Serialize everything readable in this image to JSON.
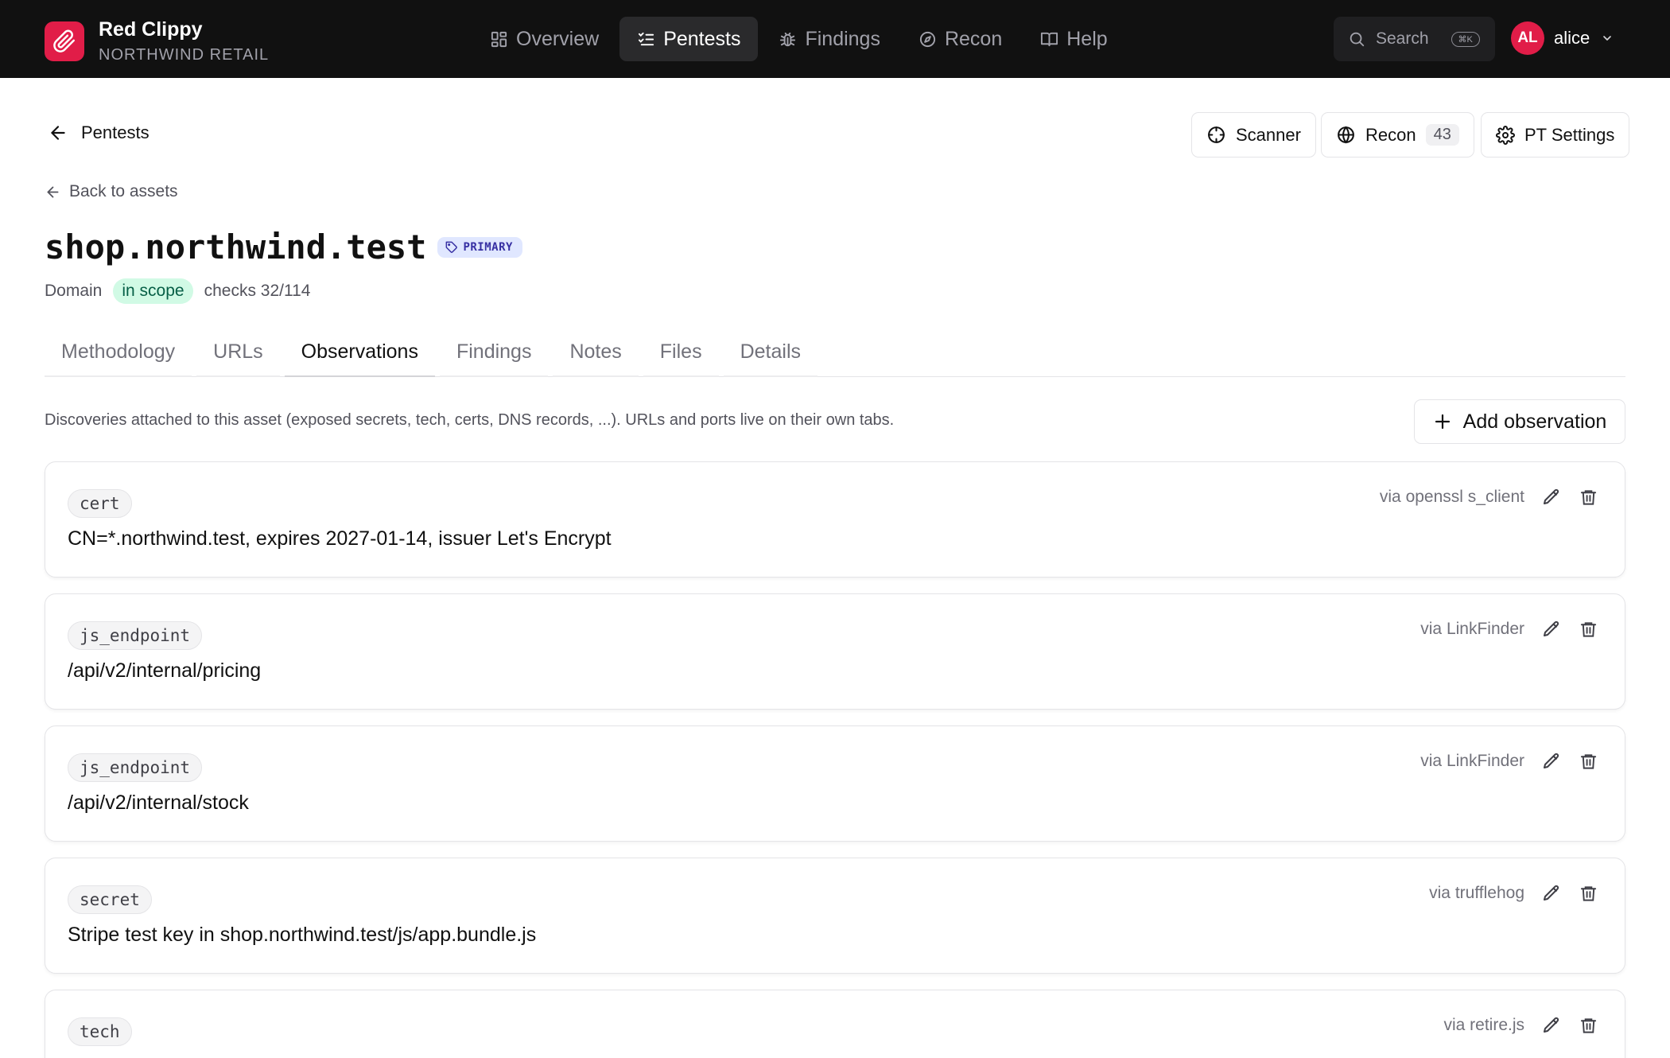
{
  "app": {
    "name": "Red Clippy",
    "org": "NORTHWIND RETAIL"
  },
  "nav": [
    {
      "label": "Overview",
      "icon": "grid-icon",
      "active": false
    },
    {
      "label": "Pentests",
      "icon": "checklist-icon",
      "active": true
    },
    {
      "label": "Findings",
      "icon": "bug-icon",
      "active": false
    },
    {
      "label": "Recon",
      "icon": "compass-icon",
      "active": false
    },
    {
      "label": "Help",
      "icon": "book-icon",
      "active": false
    }
  ],
  "search": {
    "label": "Search",
    "shortcut": "⌘K"
  },
  "user": {
    "initials": "AL",
    "name": "alice"
  },
  "header": {
    "breadcrumb": "Pentests",
    "scanner_label": "Scanner",
    "recon_label": "Recon",
    "recon_count": "43",
    "settings_label": "PT Settings"
  },
  "asset": {
    "back_label": "Back to assets",
    "title": "shop.northwind.test",
    "badge": "PRIMARY",
    "type": "Domain",
    "scope": "in scope",
    "checks": "checks 32/114"
  },
  "tabs": [
    "Methodology",
    "URLs",
    "Observations",
    "Findings",
    "Notes",
    "Files",
    "Details"
  ],
  "active_tab": "Observations",
  "observations_section": {
    "description": "Discoveries attached to this asset (exposed secrets, tech, certs, DNS records, ...). URLs and ports live on their own tabs.",
    "add_label": "Add observation",
    "items": [
      {
        "type": "cert",
        "value": "CN=*.northwind.test, expires 2027-01-14, issuer Let's Encrypt",
        "source": "via openssl s_client"
      },
      {
        "type": "js_endpoint",
        "value": "/api/v2/internal/pricing",
        "source": "via LinkFinder"
      },
      {
        "type": "js_endpoint",
        "value": "/api/v2/internal/stock",
        "source": "via LinkFinder"
      },
      {
        "type": "secret",
        "value": "Stripe test key in shop.northwind.test/js/app.bundle.js",
        "source": "via trufflehog"
      },
      {
        "type": "tech",
        "value": "",
        "source": "via retire.js"
      }
    ]
  },
  "colors": {
    "accent": "#e11d48",
    "topbar": "#111111",
    "scope_bg": "#d1fae5",
    "primary_badge_bg": "#e0e7ff"
  }
}
